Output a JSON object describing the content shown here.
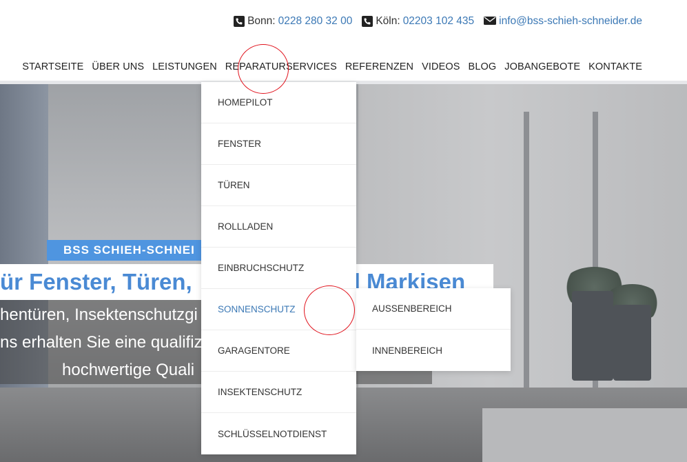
{
  "contact": {
    "bonn": {
      "label": "Bonn:",
      "value": "0228 280 32 00",
      "icon": "phone-icon"
    },
    "koeln": {
      "label": "Köln:",
      "value": "02203 102 435",
      "icon": "phone-icon"
    },
    "email": {
      "value": "info@bss-schieh-schneider.de",
      "icon": "envelope-icon"
    }
  },
  "nav": {
    "items": [
      "STARTSEITE",
      "ÜBER UNS",
      "LEISTUNGEN",
      "REPARATURSERVICES",
      "REFERENZEN",
      "VIDEOS",
      "BLOG",
      "JOBANGEBOTE",
      "KONTAKTE"
    ]
  },
  "dropdown": {
    "items": [
      "HOMEPILOT",
      "FENSTER",
      "TÜREN",
      "ROLLLADEN",
      "EINBRUCHSCHUTZ",
      "SONNENSCHUTZ",
      "GARAGENTORE",
      "INSEKTENSCHUTZ",
      "SCHLÜSSELNOTDIENST"
    ],
    "active": "SONNENSCHUTZ",
    "submenu": [
      "AUSSENBEREICH",
      "INNENBEREICH"
    ]
  },
  "hero": {
    "badge": "BSS SCHIEH-SCHNEI",
    "title": "ür Fenster, Türen,",
    "title_right": "d Markisen",
    "lines": [
      "hentüren, Insektenschutzgi",
      "ns erhalten Sie eine qualifiz",
      "hochwertige Quali"
    ]
  },
  "colors": {
    "accent": "#3b78b5",
    "badge": "#4f95e0",
    "marker": "#e0101a"
  }
}
